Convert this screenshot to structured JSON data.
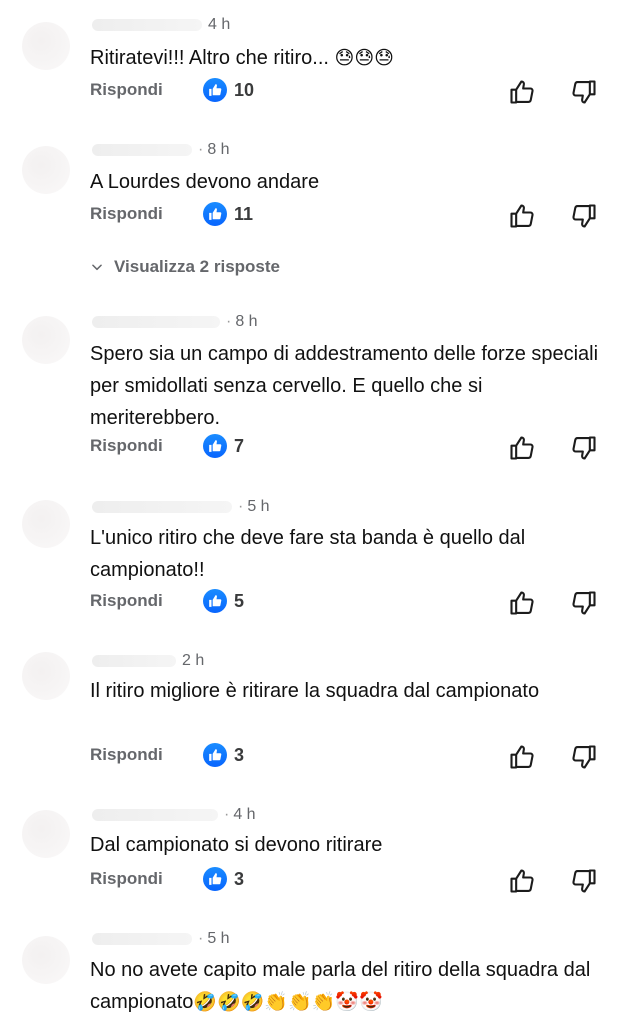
{
  "comments": [
    {
      "time": "4 h",
      "text": "Ritiratevi!!! Altro che ritiro...",
      "emojis": "😓😓😓",
      "reply_label": "Rispondi",
      "likes": "10"
    },
    {
      "time": "8 h",
      "text": "A Lourdes  devono andare",
      "reply_label": "Rispondi",
      "likes": "11"
    },
    {
      "time": "8 h",
      "text": "Spero sia un campo di addestramento delle forze speciali per smidollati senza cervello. E quello che si meriterebbero.",
      "reply_label": "Rispondi",
      "likes": "7"
    },
    {
      "time": "5 h",
      "text": "L'unico ritiro che deve fare sta banda è quello dal campionato!!",
      "reply_label": "Rispondi",
      "likes": "5"
    },
    {
      "time": "2 h",
      "text": "Il ritiro migliore è ritirare la squadra dal campionato",
      "reply_label": "Rispondi",
      "likes": "3"
    },
    {
      "time": "4 h",
      "text": "Dal campionato si devono ritirare",
      "reply_label": "Rispondi",
      "likes": "3"
    },
    {
      "time": "5 h",
      "text": "No no avete capito male parla del ritiro della squadra dal campionato",
      "emojis": "🤣🤣🤣👏👏👏🤡🤡"
    }
  ],
  "view_replies": {
    "label": "Visualizza 2 risposte"
  },
  "icons": {
    "like_badge": "thumbs-up-icon",
    "upvote": "thumb-up-outline-icon",
    "downvote": "thumb-down-outline-icon",
    "expand": "chevron-down-icon"
  },
  "colors": {
    "like_blue": "#0866ff",
    "secondary_text": "#65676b"
  }
}
